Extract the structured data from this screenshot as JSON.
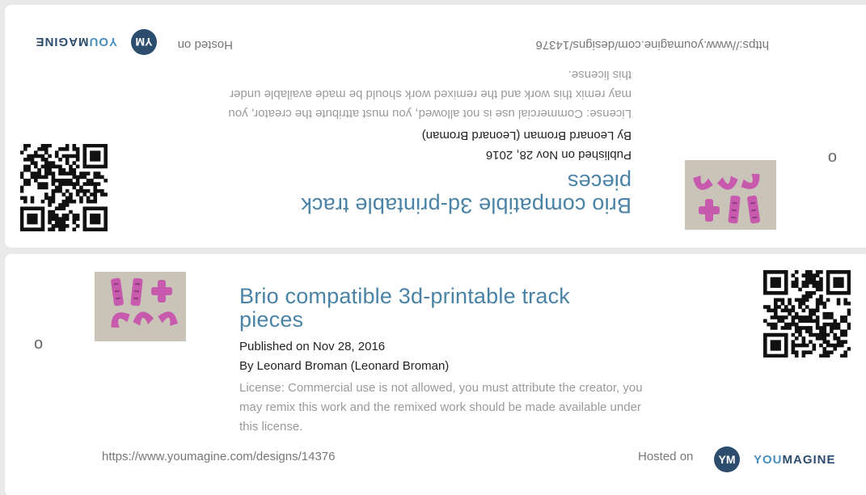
{
  "design": {
    "title": "Brio compatible 3d-printable track pieces",
    "published": "Published on Nov 28, 2016",
    "author": "By Leonard Broman (Leonard Broman)",
    "license": "License: Commercial use is not allowed, you must attribute the creator, you may remix this work and the remixed work should be made available under this license.",
    "url": "https://www.youmagine.com/designs/14376"
  },
  "footer": {
    "hosted_label": "Hosted on",
    "badge_text": "YM",
    "brand_you": "YOU",
    "brand_magine": "MAGINE"
  },
  "cards": [
    {
      "fold_mark": "o",
      "orientation": "upside-down"
    },
    {
      "fold_mark": "o",
      "orientation": "upright"
    }
  ],
  "colors": {
    "title": "#4a83a6",
    "brand_dark": "#2c4d6e",
    "brand_light": "#4a8fc0",
    "track_piece": "#c85aae",
    "photo_background": "#c9c3b8"
  }
}
